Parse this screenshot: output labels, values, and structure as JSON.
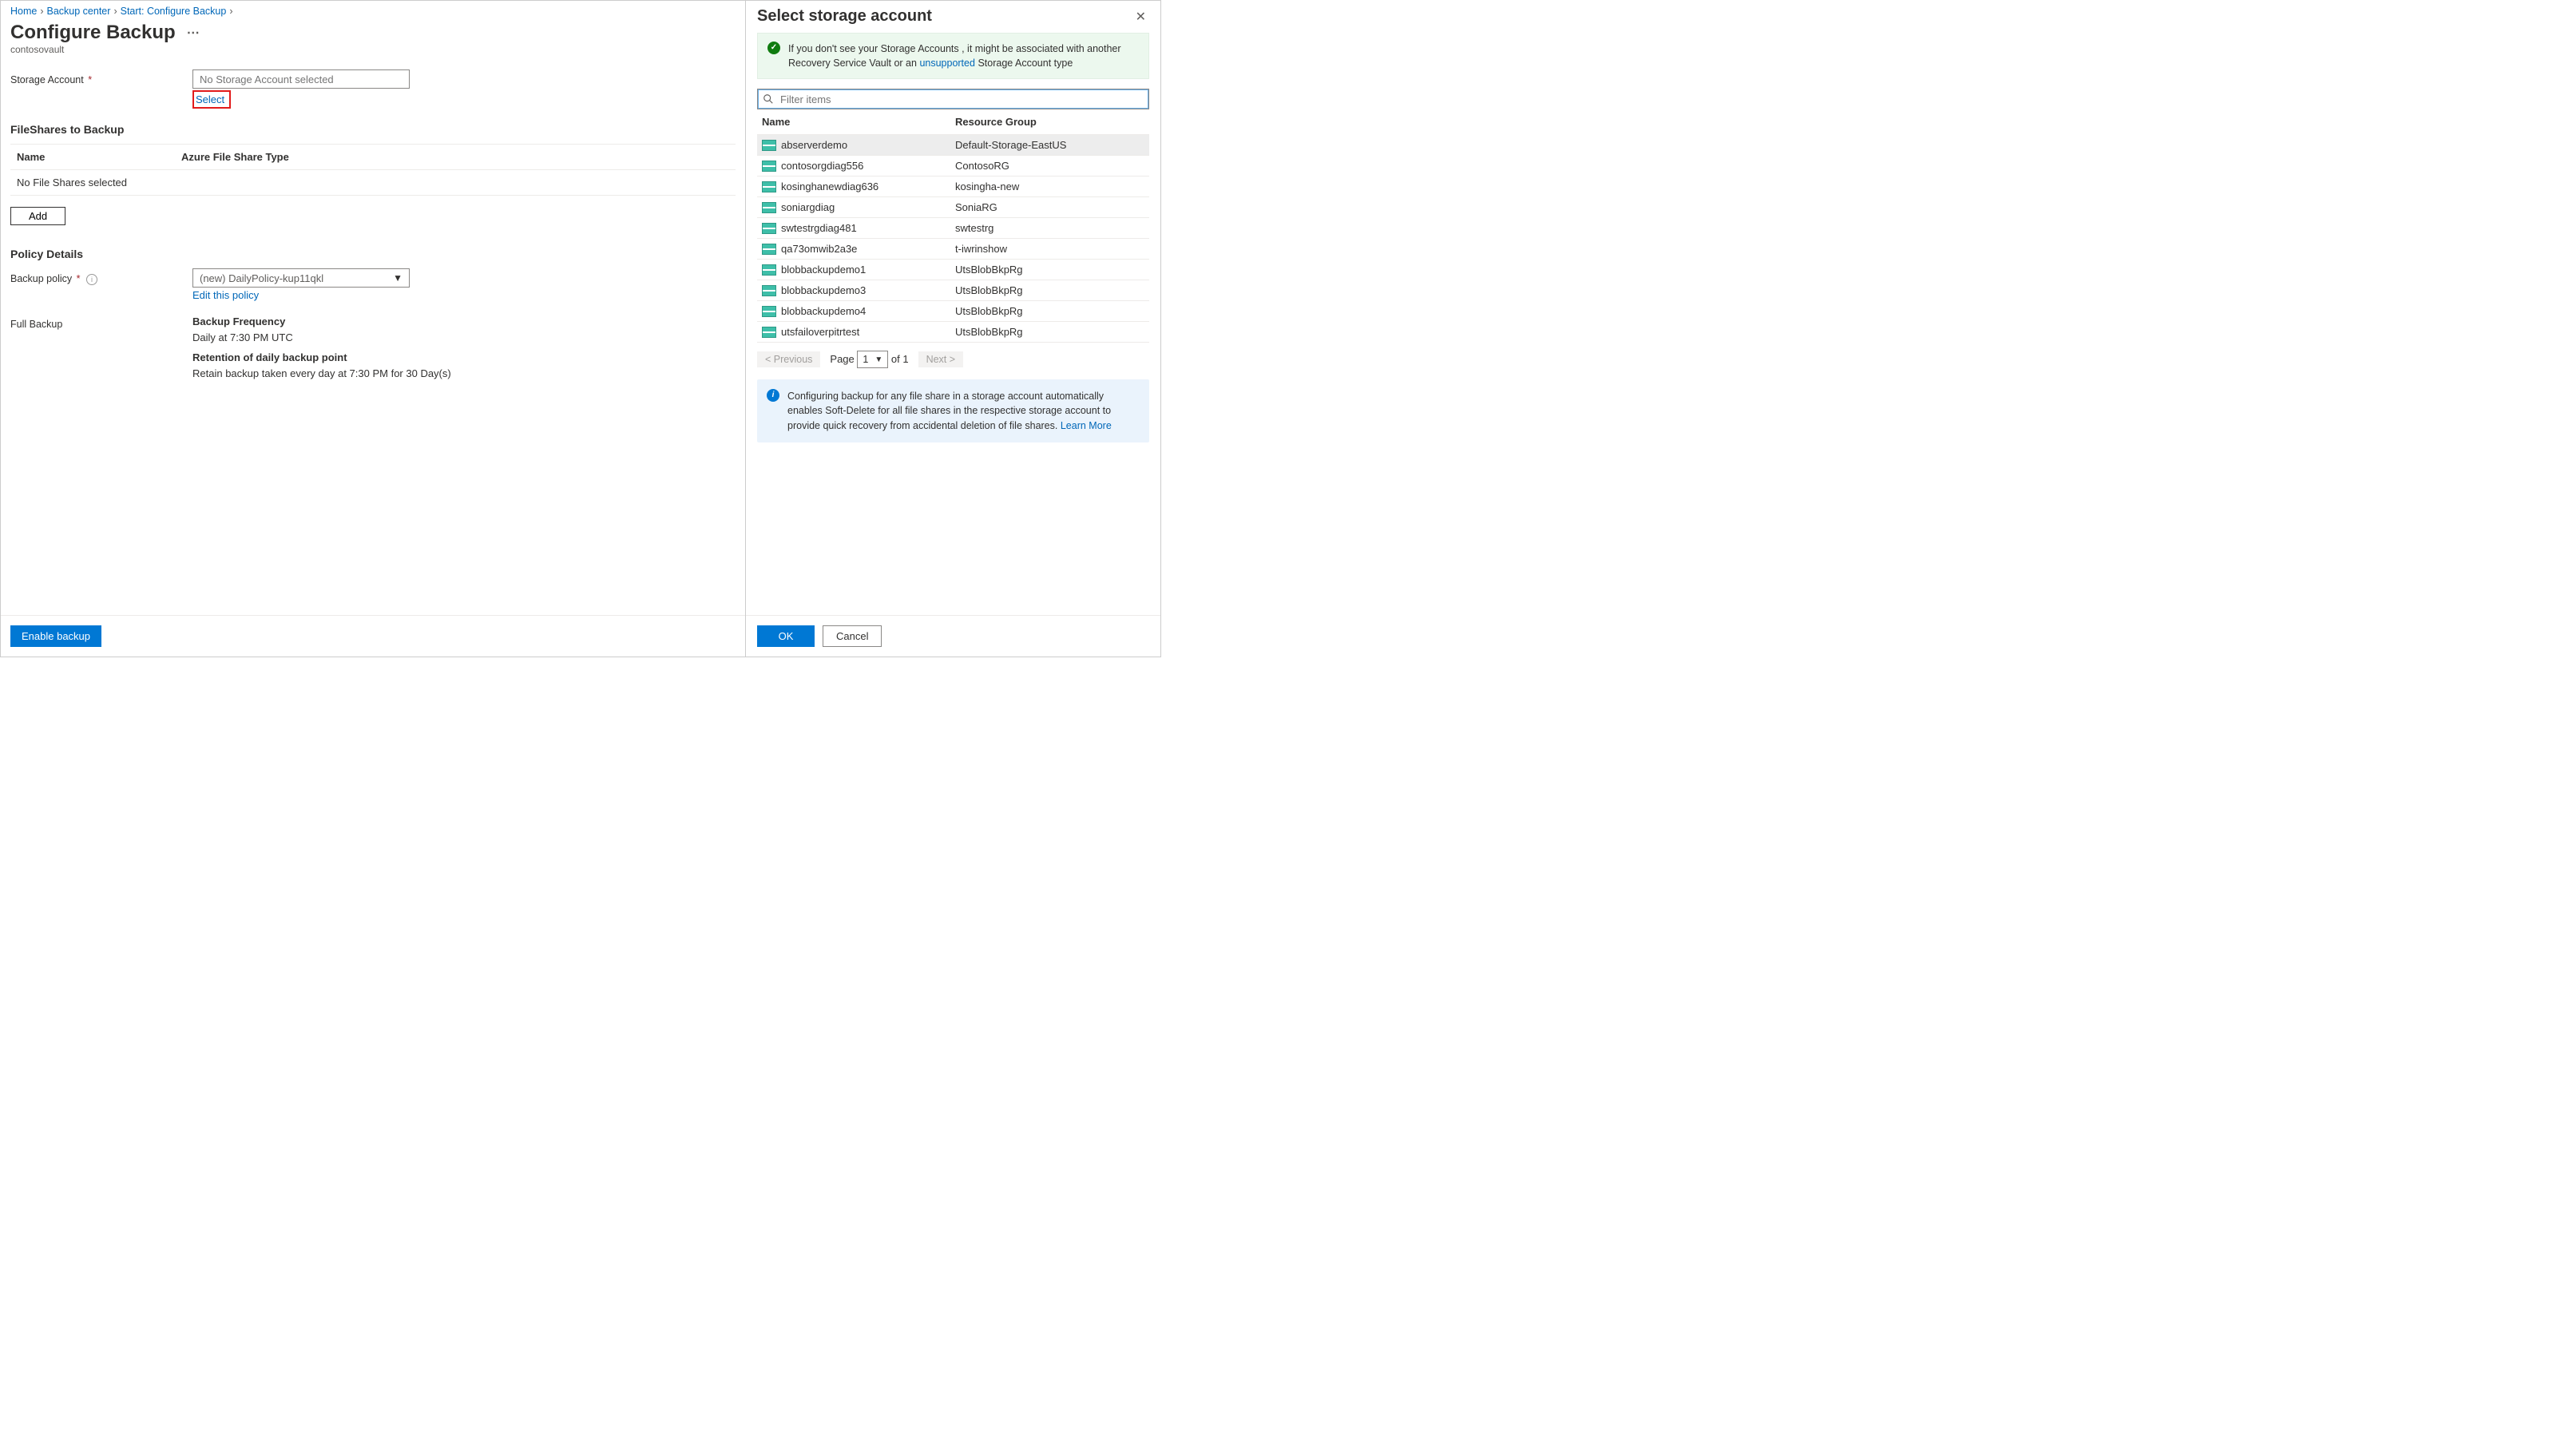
{
  "breadcrumbs": [
    "Home",
    "Backup center",
    "Start: Configure Backup"
  ],
  "page": {
    "title": "Configure Backup",
    "subtitle": "contosovault"
  },
  "storageAccount": {
    "label": "Storage Account",
    "placeholder": "No Storage Account selected",
    "select_link": "Select"
  },
  "fileshares": {
    "heading": "FileShares to Backup",
    "col_name": "Name",
    "col_type": "Azure File Share Type",
    "empty_text": "No File Shares selected",
    "add_label": "Add"
  },
  "policy": {
    "heading": "Policy Details",
    "backup_policy_label": "Backup policy",
    "selected_policy": "(new) DailyPolicy-kup11qkl",
    "edit_link": "Edit this policy",
    "full_backup_label": "Full Backup",
    "freq_label": "Backup Frequency",
    "freq_value": "Daily at 7:30 PM UTC",
    "ret_label": "Retention of daily backup point",
    "ret_value": "Retain backup taken every day at 7:30 PM for 30 Day(s)"
  },
  "footer": {
    "enable_label": "Enable backup"
  },
  "panel": {
    "title": "Select storage account",
    "ok_msg_pre": "If you don't see your Storage Accounts , it might be associated with another Recovery Service Vault or an ",
    "ok_msg_link": "unsupported",
    "ok_msg_post": " Storage Account type",
    "filter_placeholder": "Filter items",
    "col_name": "Name",
    "col_rg": "Resource Group",
    "rows": [
      {
        "name": "abserverdemo",
        "rg": "Default-Storage-EastUS",
        "sel": true
      },
      {
        "name": "contosorgdiag556",
        "rg": "ContosoRG"
      },
      {
        "name": "kosinghanewdiag636",
        "rg": "kosingha-new"
      },
      {
        "name": "soniargdiag",
        "rg": "SoniaRG"
      },
      {
        "name": "swtestrgdiag481",
        "rg": "swtestrg"
      },
      {
        "name": "qa73omwib2a3e",
        "rg": "t-iwrinshow"
      },
      {
        "name": "blobbackupdemo1",
        "rg": "UtsBlobBkpRg"
      },
      {
        "name": "blobbackupdemo3",
        "rg": "UtsBlobBkpRg"
      },
      {
        "name": "blobbackupdemo4",
        "rg": "UtsBlobBkpRg"
      },
      {
        "name": "utsfailoverpitrtest",
        "rg": "UtsBlobBkpRg"
      }
    ],
    "prev_label": "< Previous",
    "next_label": "Next >",
    "page_label_pre": "Page",
    "page_num": "1",
    "page_label_post": "of 1",
    "info_text": "Configuring backup for any file share in a storage account automatically enables Soft-Delete for all file shares in the respective storage account to provide quick recovery from accidental deletion of file shares. ",
    "learn_link": "Learn More",
    "ok_btn": "OK",
    "cancel_btn": "Cancel"
  }
}
